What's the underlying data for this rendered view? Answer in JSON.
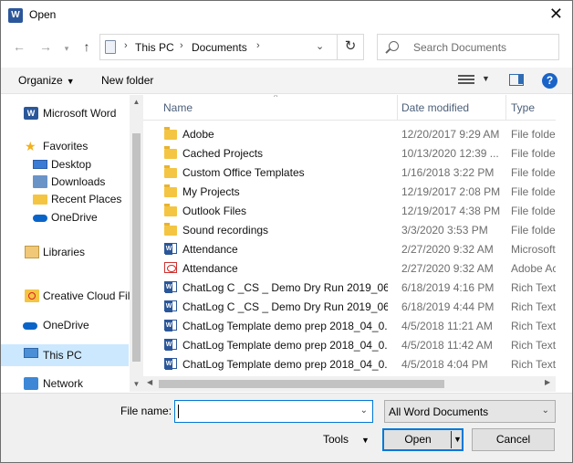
{
  "window": {
    "title": "Open",
    "app_icon_letter": "W"
  },
  "address": {
    "crumbs": [
      "This PC",
      "Documents"
    ],
    "search_placeholder": "Search Documents"
  },
  "toolbar": {
    "organize": "Organize",
    "new_folder": "New folder",
    "help": "?"
  },
  "nav": {
    "microsoft_word": "Microsoft Word",
    "favorites": "Favorites",
    "desktop": "Desktop",
    "downloads": "Downloads",
    "recent_places": "Recent Places",
    "onedrive_fav": "OneDrive",
    "libraries": "Libraries",
    "creative_cloud": "Creative Cloud Fil",
    "onedrive": "OneDrive",
    "this_pc": "This PC",
    "network": "Network"
  },
  "columns": {
    "name": "Name",
    "date_modified": "Date modified",
    "type": "Type"
  },
  "files": [
    {
      "icon": "folder-icon",
      "name": "Adobe",
      "date": "12/20/2017 9:29 AM",
      "type": "File folde"
    },
    {
      "icon": "folder-icon",
      "name": "Cached Projects",
      "date": "10/13/2020 12:39 ...",
      "type": "File folde"
    },
    {
      "icon": "folder-icon",
      "name": "Custom Office Templates",
      "date": "1/16/2018 3:22 PM",
      "type": "File folde"
    },
    {
      "icon": "folder-icon",
      "name": "My Projects",
      "date": "12/19/2017 2:08 PM",
      "type": "File folde"
    },
    {
      "icon": "folder-icon",
      "name": "Outlook Files",
      "date": "12/19/2017 4:38 PM",
      "type": "File folde"
    },
    {
      "icon": "folder-icon",
      "name": "Sound recordings",
      "date": "3/3/2020 3:53 PM",
      "type": "File folde"
    },
    {
      "icon": "word-doc-icon",
      "name": "Attendance",
      "date": "2/27/2020 9:32 AM",
      "type": "Microsoft"
    },
    {
      "icon": "pdf-icon",
      "name": "Attendance",
      "date": "2/27/2020 9:32 AM",
      "type": "Adobe Ac"
    },
    {
      "icon": "rtf-icon",
      "name": "ChatLog C _CS _ Demo Dry Run 2019_06_...",
      "date": "6/18/2019 4:16 PM",
      "type": "Rich Text"
    },
    {
      "icon": "rtf-icon",
      "name": "ChatLog C _CS _ Demo Dry Run 2019_06_...",
      "date": "6/18/2019 4:44 PM",
      "type": "Rich Text"
    },
    {
      "icon": "rtf-icon",
      "name": "ChatLog Template demo prep 2018_04_0...",
      "date": "4/5/2018 11:21 AM",
      "type": "Rich Text"
    },
    {
      "icon": "rtf-icon",
      "name": "ChatLog Template demo prep 2018_04_0...",
      "date": "4/5/2018 11:42 AM",
      "type": "Rich Text"
    },
    {
      "icon": "rtf-icon",
      "name": "ChatLog Template demo prep 2018_04_0...",
      "date": "4/5/2018 4:04 PM",
      "type": "Rich Text"
    }
  ],
  "bottom": {
    "file_name_label": "File name:",
    "file_name_value": "",
    "filter_value": "All Word Documents",
    "tools": "Tools",
    "open": "Open",
    "cancel": "Cancel"
  }
}
